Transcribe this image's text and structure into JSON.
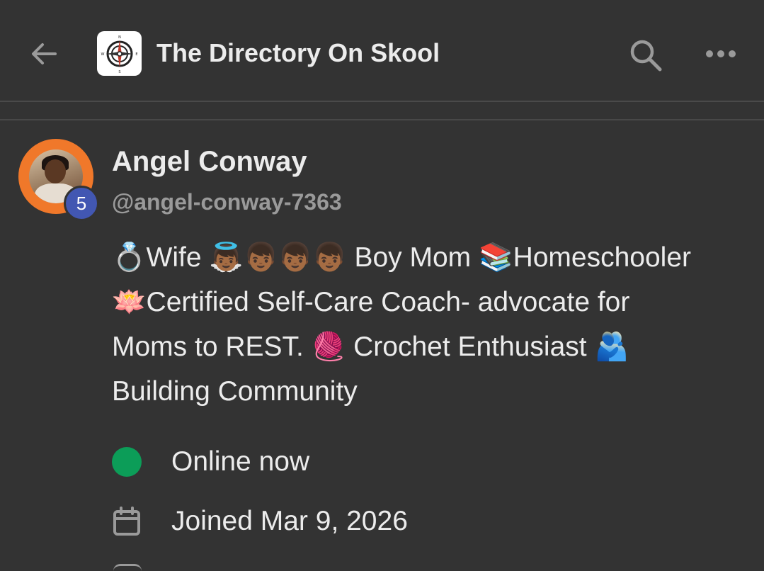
{
  "header": {
    "title": "The Directory On Skool",
    "back_icon": "arrow-left-icon",
    "logo_icon": "compass-icon",
    "search_icon": "search-icon",
    "more_icon": "more-horizontal-icon"
  },
  "profile": {
    "name": "Angel Conway",
    "handle": "@angel-conway-7363",
    "level": "5",
    "avatar_ring_color": "#f0782a",
    "level_badge_color": "#4257b2",
    "bio_lines": [
      "💍Wife 👼🏾👦🏾👦🏾👦🏾 Boy Mom 📚Homeschooler",
      "🪷Certified Self-Care Coach- advocate for",
      "Moms to REST. 🧶 Crochet Enthusiast 🫂",
      "Building Community"
    ]
  },
  "meta": {
    "online_text": "Online now",
    "online_color": "#0c9d58",
    "joined_text": "Joined Mar 9, 2026",
    "calendar_icon": "calendar-icon"
  },
  "colors": {
    "background": "#333333",
    "text": "#ececec",
    "muted": "#9a9a9a"
  }
}
